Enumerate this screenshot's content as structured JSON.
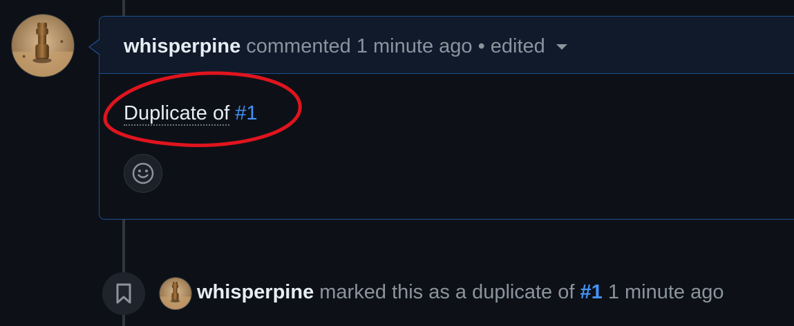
{
  "comment": {
    "author": "whisperpine",
    "action": "commented",
    "time": "1 minute ago",
    "separator": "•",
    "edited": "edited",
    "body_text": "Duplicate of",
    "issue_ref": "#1"
  },
  "event": {
    "author": "whisperpine",
    "action": "marked this as a duplicate of",
    "issue_ref": "#1",
    "time": "1 minute ago"
  },
  "icons": {
    "emoji": "smiley-icon",
    "event": "bookmark-icon",
    "caret": "caret-down-icon"
  },
  "colors": {
    "background": "#0d1117",
    "link": "#4493f8",
    "border_highlight": "#1f4d8f",
    "annotation": "#e0141e"
  }
}
